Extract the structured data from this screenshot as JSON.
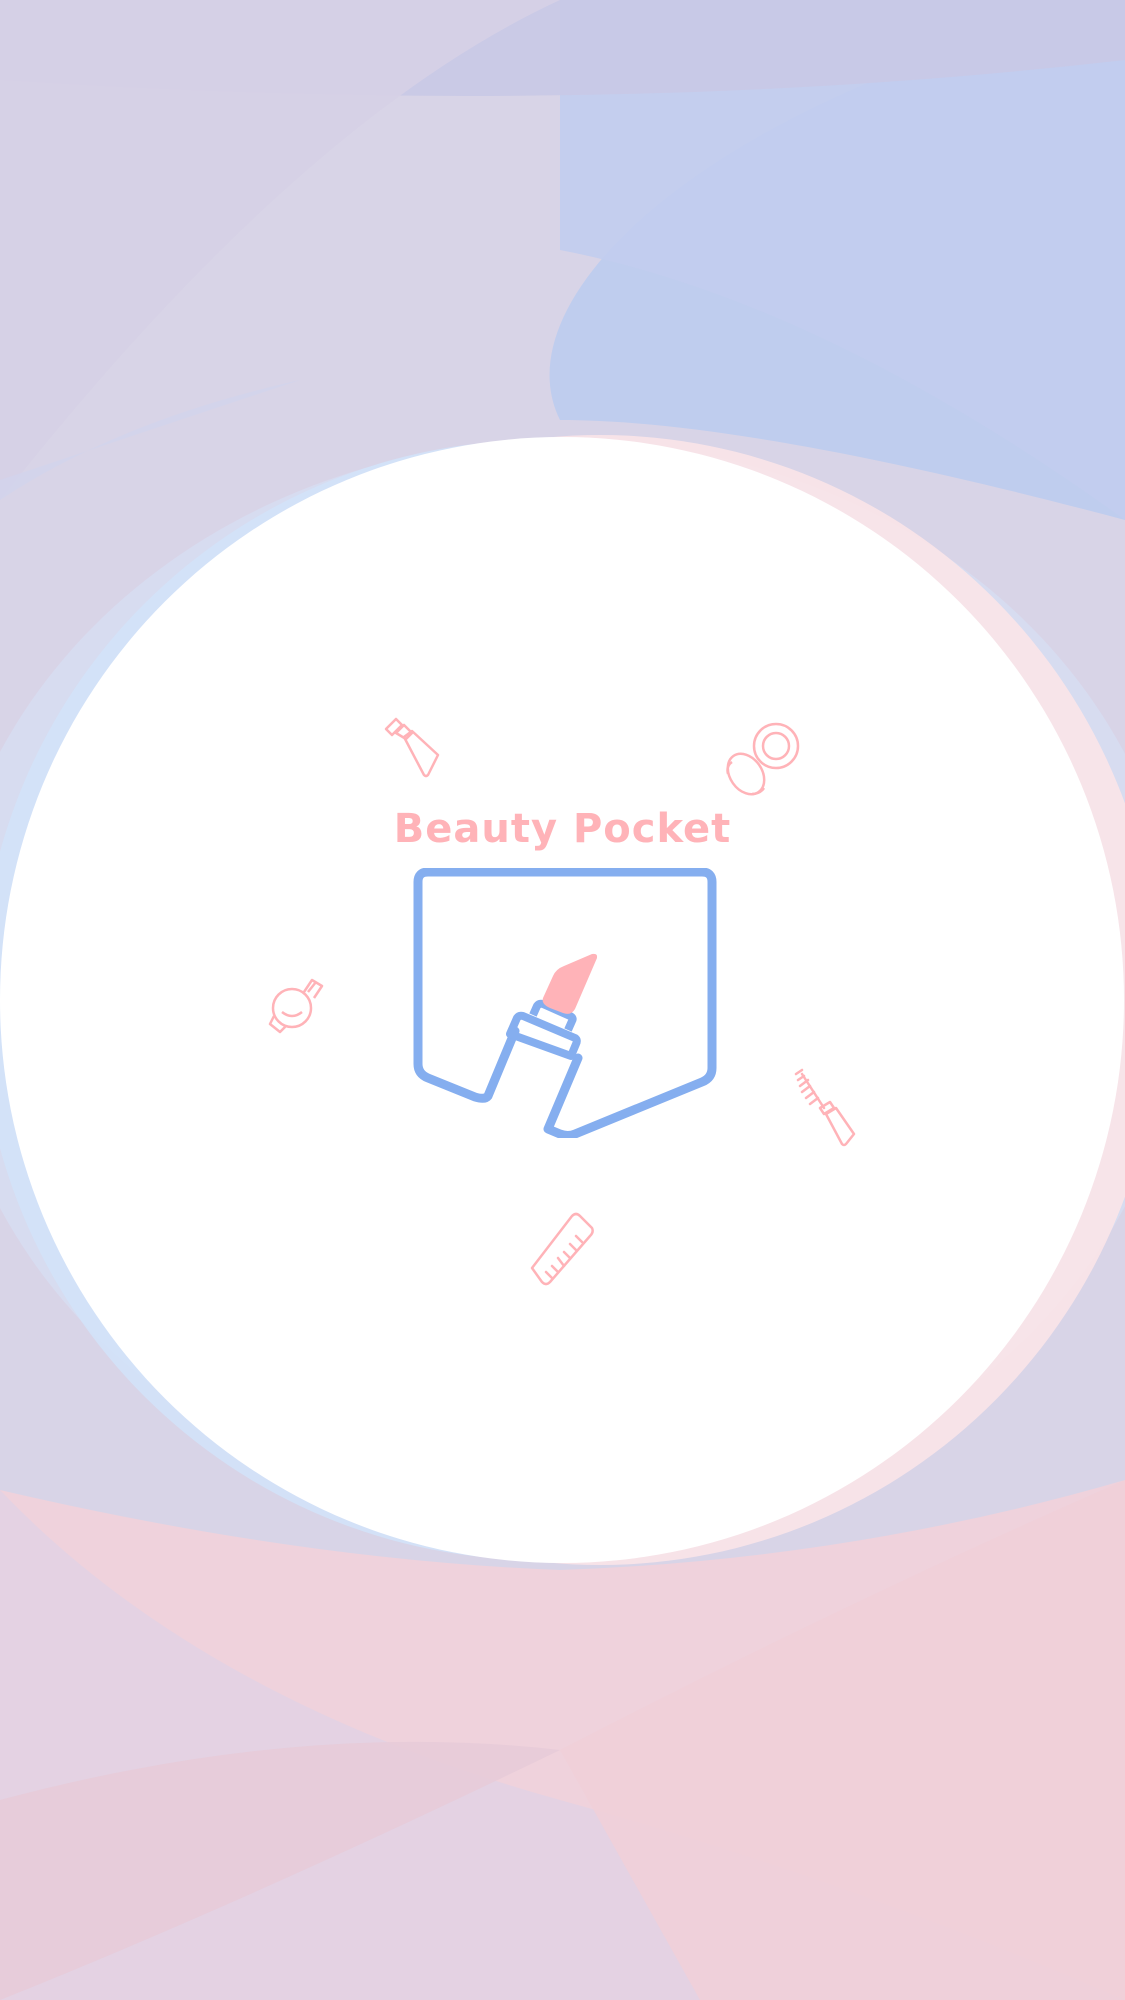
{
  "splash": {
    "app_name": "Beauty Pocket",
    "logo_icon": "pocket-with-lipstick-icon",
    "decorative_icons": [
      "nail-polish-icon",
      "compact-powder-icon",
      "perfume-bottle-icon",
      "mascara-wand-icon",
      "comb-icon"
    ]
  },
  "colors": {
    "brand_pink": "#ffb3b8",
    "brand_blue": "#85aeef",
    "background_lavender": "#d6d2e6",
    "background_blue": "#c1cfee",
    "background_pink": "#efd0da",
    "circle_fill": "#ffffff"
  }
}
